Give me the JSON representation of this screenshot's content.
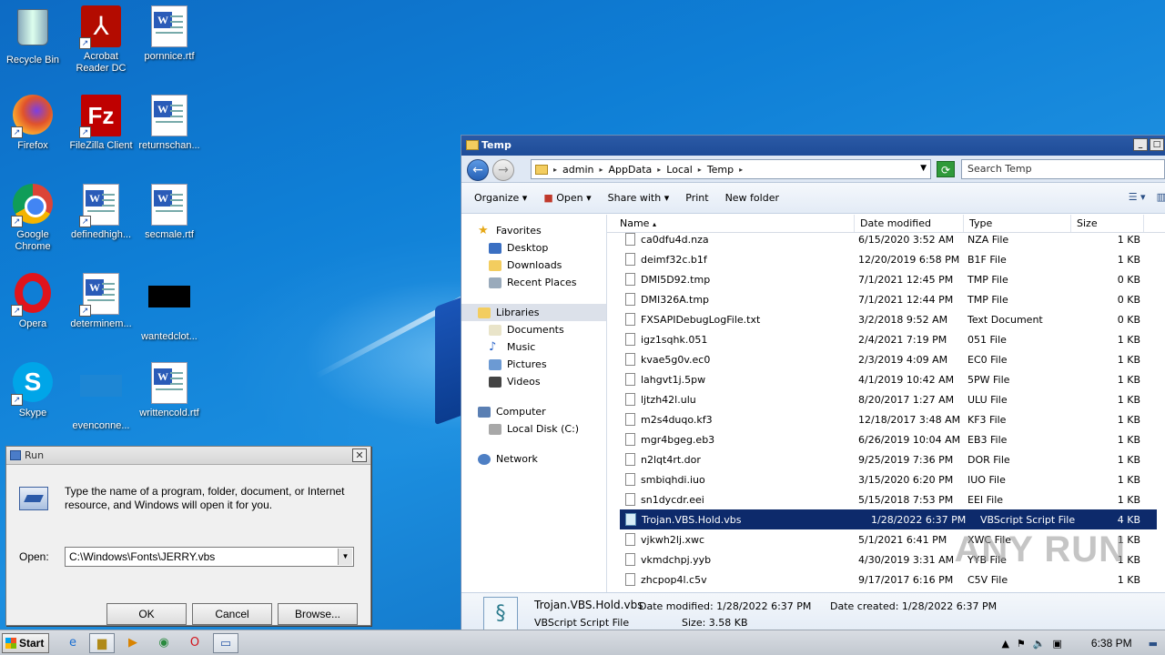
{
  "desktop": {
    "icons": [
      {
        "label": "Recycle Bin"
      },
      {
        "label": "Acrobat Reader DC"
      },
      {
        "label": "pornnice.rtf"
      },
      {
        "label": "Firefox"
      },
      {
        "label": "FileZilla Client"
      },
      {
        "label": "returnschan..."
      },
      {
        "label": "Google Chrome"
      },
      {
        "label": "definedhigh..."
      },
      {
        "label": "secmale.rtf"
      },
      {
        "label": "Opera"
      },
      {
        "label": "determinem..."
      },
      {
        "label": "wantedclot..."
      },
      {
        "label": "Skype"
      },
      {
        "label": "evenconne..."
      },
      {
        "label": "writtencold.rtf"
      }
    ]
  },
  "explorer": {
    "title": "Temp",
    "breadcrumb": [
      "admin",
      "AppData",
      "Local",
      "Temp"
    ],
    "search_placeholder": "Search Temp",
    "toolbar": {
      "organize": "Organize",
      "open": "Open",
      "share_with": "Share with",
      "print": "Print",
      "new_folder": "New folder"
    },
    "nav": {
      "favorites": "Favorites",
      "desktop": "Desktop",
      "downloads": "Downloads",
      "recent_places": "Recent Places",
      "libraries": "Libraries",
      "documents": "Documents",
      "music": "Music",
      "pictures": "Pictures",
      "videos": "Videos",
      "computer": "Computer",
      "local_disk": "Local Disk (C:)",
      "network": "Network"
    },
    "columns": {
      "name": "Name",
      "date": "Date modified",
      "type": "Type",
      "size": "Size"
    },
    "files": [
      {
        "name": "ca0dfu4d.nza",
        "date": "6/15/2020 3:52 AM",
        "type": "NZA File",
        "size": "1 KB"
      },
      {
        "name": "deimf32c.b1f",
        "date": "12/20/2019 6:58 PM",
        "type": "B1F File",
        "size": "1 KB"
      },
      {
        "name": "DMI5D92.tmp",
        "date": "7/1/2021 12:45 PM",
        "type": "TMP File",
        "size": "0 KB"
      },
      {
        "name": "DMI326A.tmp",
        "date": "7/1/2021 12:44 PM",
        "type": "TMP File",
        "size": "0 KB"
      },
      {
        "name": "FXSAPIDebugLogFile.txt",
        "date": "3/2/2018 9:52 AM",
        "type": "Text Document",
        "size": "0 KB"
      },
      {
        "name": "igz1sqhk.051",
        "date": "2/4/2021 7:19 PM",
        "type": "051 File",
        "size": "1 KB"
      },
      {
        "name": "kvae5g0v.ec0",
        "date": "2/3/2019 4:09 AM",
        "type": "EC0 File",
        "size": "1 KB"
      },
      {
        "name": "lahgvt1j.5pw",
        "date": "4/1/2019 10:42 AM",
        "type": "5PW File",
        "size": "1 KB"
      },
      {
        "name": "ljtzh42l.ulu",
        "date": "8/20/2017 1:27 AM",
        "type": "ULU File",
        "size": "1 KB"
      },
      {
        "name": "m2s4duqo.kf3",
        "date": "12/18/2017 3:48 AM",
        "type": "KF3 File",
        "size": "1 KB"
      },
      {
        "name": "mgr4bgeg.eb3",
        "date": "6/26/2019 10:04 AM",
        "type": "EB3 File",
        "size": "1 KB"
      },
      {
        "name": "n2lqt4rt.dor",
        "date": "9/25/2019 7:36 PM",
        "type": "DOR File",
        "size": "1 KB"
      },
      {
        "name": "smbiqhdi.iuo",
        "date": "3/15/2020 6:20 PM",
        "type": "IUO File",
        "size": "1 KB"
      },
      {
        "name": "sn1dycdr.eei",
        "date": "5/15/2018 7:53 PM",
        "type": "EEI File",
        "size": "1 KB"
      },
      {
        "name": "Trojan.VBS.Hold.vbs",
        "date": "1/28/2022 6:37 PM",
        "type": "VBScript Script File",
        "size": "4 KB"
      },
      {
        "name": "vjkwh2lj.xwc",
        "date": "5/1/2021 6:41 PM",
        "type": "XWC File",
        "size": "1 KB"
      },
      {
        "name": "vkmdchpj.yyb",
        "date": "4/30/2019 3:31 AM",
        "type": "YYB File",
        "size": "1 KB"
      },
      {
        "name": "zhcpop4l.c5v",
        "date": "9/17/2017 6:16 PM",
        "type": "C5V File",
        "size": "1 KB"
      }
    ],
    "details": {
      "name": "Trojan.VBS.Hold.vbs",
      "type": "VBScript Script File",
      "modified_label": "Date modified:",
      "modified": "1/28/2022 6:37 PM",
      "created_label": "Date created:",
      "created": "1/28/2022 6:37 PM",
      "size_label": "Size:",
      "size": "3.58 KB"
    },
    "watermark": "ANY RUN"
  },
  "run_dialog": {
    "title": "Run",
    "message": "Type the name of a program, folder, document, or Internet resource, and Windows will open it for you.",
    "open_label": "Open:",
    "open_value": "C:\\Windows\\Fonts\\JERRY.vbs",
    "ok": "OK",
    "cancel": "Cancel",
    "browse": "Browse..."
  },
  "taskbar": {
    "start": "Start",
    "clock": "6:38 PM"
  }
}
